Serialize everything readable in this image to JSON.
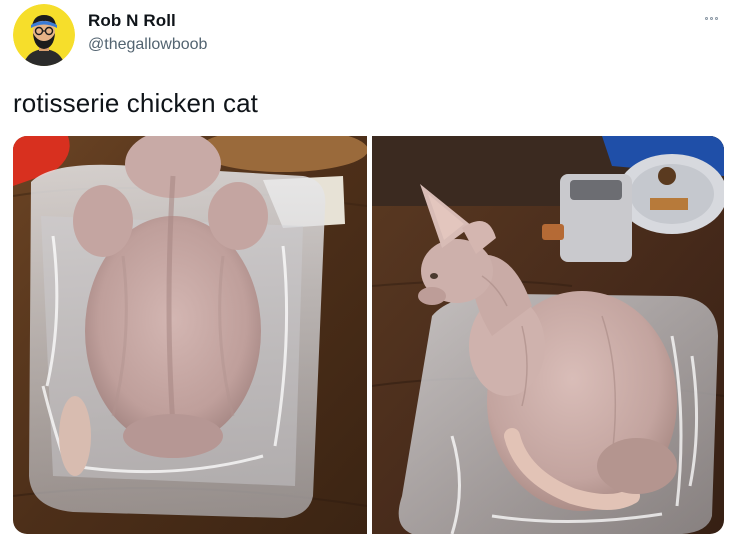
{
  "tweet": {
    "author": {
      "display_name": "Rob N Roll",
      "handle": "@thegallowboob",
      "avatar_icon": "bearded-man-avatar"
    },
    "more_icon": "more-options-icon",
    "text": "rotisserie chicken cat",
    "media": [
      {
        "id": "photo-left",
        "subject": "hairless cat crouched in clear plastic tray, back view"
      },
      {
        "id": "photo-right",
        "subject": "hairless cat crouched in clear plastic tray, side view"
      }
    ]
  },
  "colors": {
    "text_primary": "#0f1419",
    "text_secondary": "#536471",
    "avatar_bg": "#f6de2b",
    "table_wood": "#5a3a22",
    "cat_skin": "#c7a9a4"
  }
}
